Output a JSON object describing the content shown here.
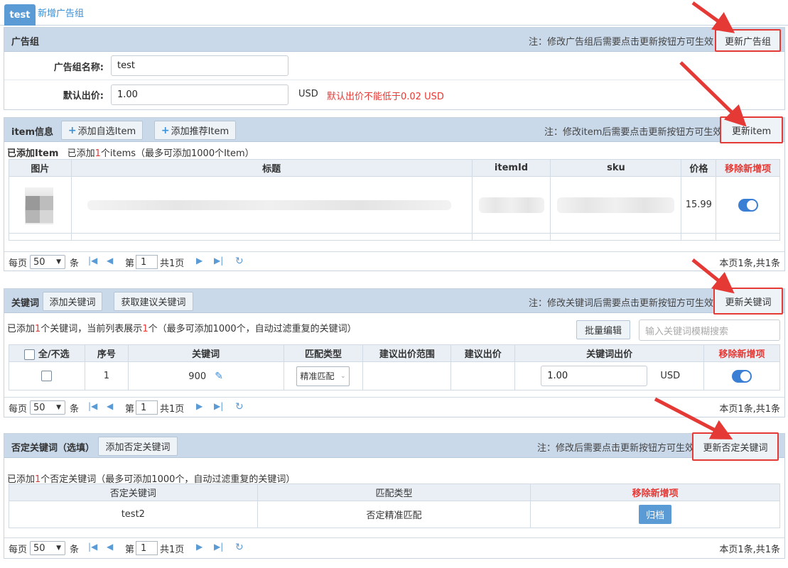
{
  "tabs": {
    "active": "test",
    "new_group": "新增广告组"
  },
  "ad_group": {
    "title": "广告组",
    "note": "注：修改广告组后需要点击更新按钮方可生效",
    "update_btn": "更新广告组",
    "name_label": "广告组名称:",
    "name_value": "test",
    "bid_label": "默认出价:",
    "bid_value": "1.00",
    "currency": "USD",
    "bid_warning": "默认出价不能低于0.02 USD"
  },
  "items": {
    "title": "item信息",
    "add_custom_btn": "添加自选Item",
    "add_recommended_btn": "添加推荐Item",
    "note": "注：修改item后需要点击更新按钮方可生效",
    "update_btn": "更新item",
    "added_label": "已添加Item",
    "added_prefix": "已添加",
    "added_count": "1",
    "added_suffix": "个items（最多可添加1000个Item）",
    "columns": [
      "图片",
      "标题",
      "itemId",
      "sku",
      "价格",
      "移除新增项"
    ],
    "rows": [
      {
        "price": "15.99",
        "enabled": true
      }
    ],
    "pager": {
      "per_page_label": "每页",
      "per_page": "50",
      "unit": "条",
      "page_prefix": "第",
      "page": "1",
      "total_pages": "共1页",
      "summary": "本页1条,共1条"
    }
  },
  "keywords": {
    "title": "关键词",
    "add_btn": "添加关键词",
    "suggest_btn": "获取建议关键词",
    "note": "注：修改关键词后需要点击更新按钮方可生效",
    "update_btn": "更新关键词",
    "info_prefix": "已添加",
    "info_count": "1",
    "info_mid": "个关键词，当前列表展示",
    "info_count2": "1",
    "info_suffix": "个（最多可添加1000个，自动过滤重复的关键词）",
    "batch_edit_btn": "批量编辑",
    "search_placeholder": "输入关键词模糊搜索",
    "columns": [
      "全/不选",
      "序号",
      "关键词",
      "匹配类型",
      "建议出价范围",
      "建议出价",
      "关键词出价",
      "移除新增项"
    ],
    "rows": [
      {
        "index": "1",
        "keyword": "900",
        "match_type": "精准匹配",
        "bid": "1.00",
        "currency": "USD",
        "enabled": true
      }
    ],
    "pager": {
      "per_page_label": "每页",
      "per_page": "50",
      "unit": "条",
      "page_prefix": "第",
      "page": "1",
      "total_pages": "共1页",
      "summary": "本页1条,共1条"
    }
  },
  "negative": {
    "title": "否定关键词（选填）",
    "add_btn": "添加否定关键词",
    "note": "注：修改后需要点击更新按钮方可生效",
    "update_btn": "更新否定关键词",
    "info_prefix": "已添加",
    "info_count": "1",
    "info_suffix": "个否定关键词（最多可添加1000个，自动过滤重复的关键词）",
    "columns": [
      "否定关键词",
      "匹配类型",
      "移除新增项"
    ],
    "rows": [
      {
        "keyword": "test2",
        "match_type": "否定精准匹配",
        "action": "归档"
      }
    ],
    "pager": {
      "per_page_label": "每页",
      "per_page": "50",
      "unit": "条",
      "page_prefix": "第",
      "page": "1",
      "total_pages": "共1页",
      "summary": "本页1条,共1条"
    }
  },
  "colors": {
    "accent": "#5b9bd5",
    "header_bg": "#c9d9ea",
    "highlight": "#e53935",
    "toggle": "#3a7fd4"
  }
}
